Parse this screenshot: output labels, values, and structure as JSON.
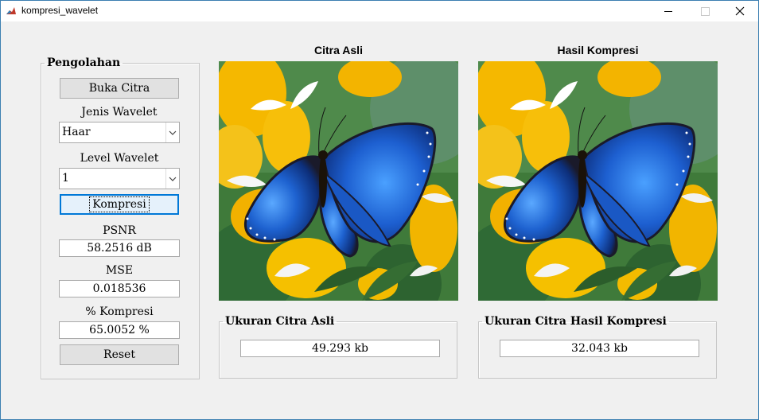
{
  "window": {
    "title": "kompresi_wavelet"
  },
  "panel": {
    "legend": "Pengolahan",
    "open_button": "Buka Citra",
    "wavelet_type_label": "Jenis Wavelet",
    "wavelet_type_value": "Haar",
    "wavelet_level_label": "Level Wavelet",
    "wavelet_level_value": "1",
    "compress_button": "Kompresi",
    "psnr_label": "PSNR",
    "psnr_value": "58.2516 dB",
    "mse_label": "MSE",
    "mse_value": "0.018536",
    "compression_label": "% Kompresi",
    "compression_value": "65.0052 %",
    "reset_button": "Reset"
  },
  "images": {
    "original_title": "Citra Asli",
    "compressed_title": "Hasil Kompresi"
  },
  "sizes": {
    "original_legend": "Ukuran Citra Asli",
    "original_value": "49.293 kb",
    "compressed_legend": "Ukuran Citra Hasil Kompresi",
    "compressed_value": "32.043 kb"
  },
  "colors": {
    "accent": "#0078d7",
    "butterfly_blue": "#1f5fc8",
    "flower_yellow": "#f5b800",
    "foliage_green": "#3f7a3a"
  }
}
